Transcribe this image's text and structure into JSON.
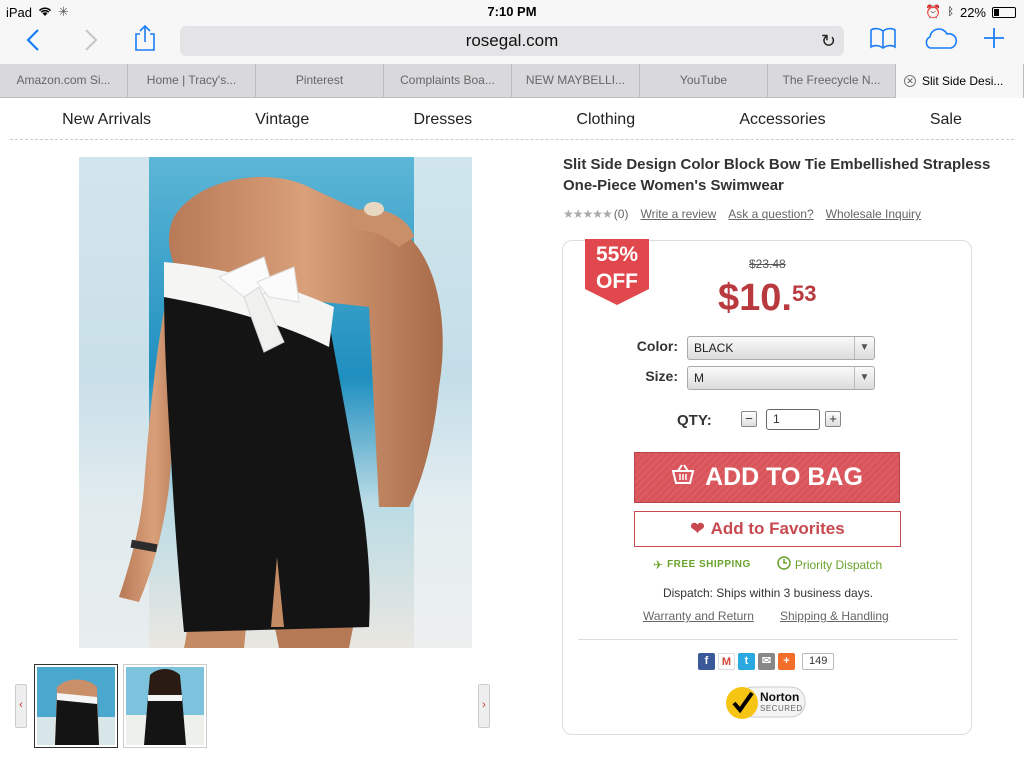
{
  "status_bar": {
    "device": "iPad",
    "time": "7:10 PM",
    "battery": "22%"
  },
  "browser": {
    "url": "rosegal.com",
    "tabs": [
      {
        "label": "Amazon.com Si..."
      },
      {
        "label": "Home | Tracy's..."
      },
      {
        "label": "Pinterest"
      },
      {
        "label": "Complaints Boa..."
      },
      {
        "label": "NEW MAYBELLI..."
      },
      {
        "label": "YouTube"
      },
      {
        "label": "The Freecycle N..."
      },
      {
        "label": "Slit Side Desi..."
      }
    ]
  },
  "nav": {
    "items": [
      {
        "label": "New Arrivals"
      },
      {
        "label": "Vintage"
      },
      {
        "label": "Dresses"
      },
      {
        "label": "Clothing"
      },
      {
        "label": "Accessories"
      },
      {
        "label": "Sale"
      }
    ]
  },
  "product": {
    "title": "Slit Side Design Color Block Bow Tie Embellished Strapless One-Piece Women's Swimwear",
    "rating_stars": 0,
    "review_count": "(0)",
    "write_review": "Write a review",
    "ask_question": "Ask a question?",
    "wholesale": "Wholesale Inquiry",
    "discount_pct": "55%",
    "discount_off": "OFF",
    "old_price": "$23.48",
    "price_main": "$10.",
    "price_cents": "53",
    "color_label": "Color:",
    "color_value": "BLACK",
    "size_label": "Size:",
    "size_value": "M",
    "qty_label": "QTY:",
    "qty_value": "1",
    "add_to_bag": "ADD TO BAG",
    "add_to_favorites": "Add to Favorites",
    "free_shipping": "FREE SHIPPING",
    "priority_dispatch": "Priority Dispatch",
    "dispatch_text": "Dispatch: Ships within 3 business days.",
    "warranty_link": "Warranty and Return",
    "shipping_link": "Shipping & Handling",
    "share_count": "149",
    "norton_label": "Norton",
    "norton_sub": "SECURED"
  },
  "colors": {
    "ios_blue": "#1a7df5",
    "price_red": "#b93a3e",
    "button_red": "#d9545a",
    "badge_red": "#e1484d",
    "shipping_green": "#6aa32c"
  }
}
